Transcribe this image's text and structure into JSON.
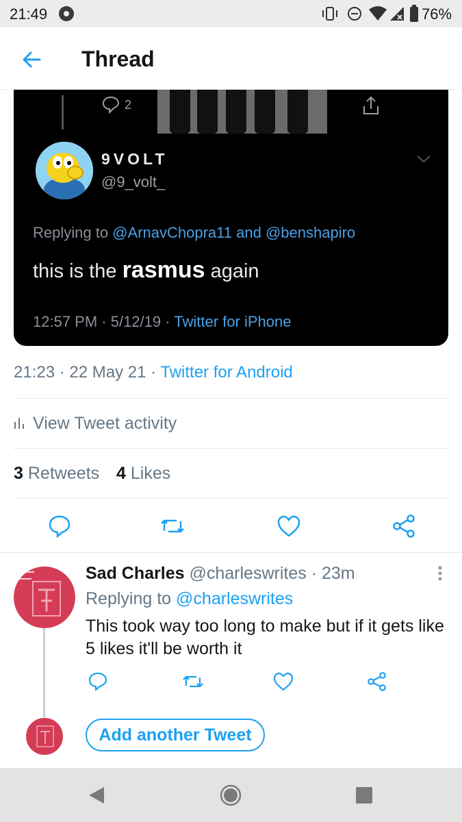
{
  "status_bar": {
    "time": "21:49",
    "battery": "76%"
  },
  "header": {
    "title": "Thread"
  },
  "embedded_tweet": {
    "reply_count": "2",
    "display_name": "9VOLT",
    "handle": "@9_volt_",
    "replying_prefix": "Replying to",
    "replying_user1": "@ArnavChopra11",
    "replying_and": "and",
    "replying_user2": "@benshapiro",
    "text_before": "this is the",
    "text_bold": "rasmus",
    "text_after": "again",
    "timestamp": "12:57 PM · 5/12/19 · ",
    "source": "Twitter for iPhone"
  },
  "tweet": {
    "timestamp": "21:23 · 22 May 21 · ",
    "source": "Twitter for Android",
    "activity_label": "View Tweet activity",
    "retweets_count": "3",
    "retweets_label": "Retweets",
    "likes_count": "4",
    "likes_label": "Likes"
  },
  "reply": {
    "display_name": "Sad Charles",
    "handle": "@charleswrites",
    "time": "· 23m",
    "replying_prefix": "Replying to",
    "replying_user": "@charleswrites",
    "text": "This took way too long to make but if it gets like 5 likes it'll be worth it"
  },
  "compose": {
    "add_label": "Add another Tweet"
  },
  "colors": {
    "accent": "#1da1f2",
    "secondary_text": "#657786",
    "avatar": "#d43c55"
  },
  "icons": [
    "back-arrow-icon",
    "comment-icon",
    "retweet-icon",
    "like-icon",
    "share-icon",
    "chart-icon",
    "more-icon",
    "nav-back-icon",
    "nav-home-icon",
    "nav-recents-icon"
  ]
}
